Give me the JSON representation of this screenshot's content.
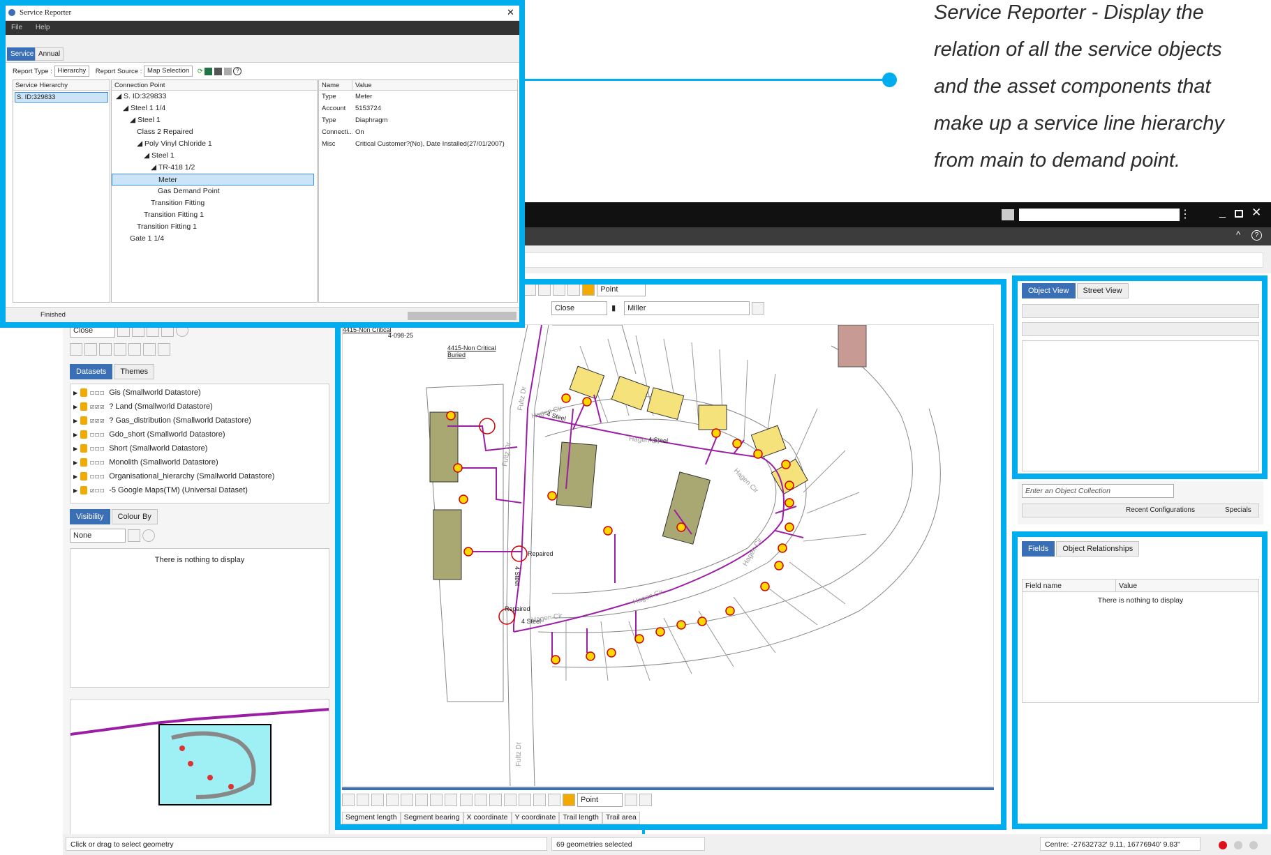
{
  "caption": {
    "lines": [
      "Service Reporter - Display the",
      "relation of all the service objects",
      "and the asset components that",
      "make up a service line hierarchy",
      "from main to demand point."
    ]
  },
  "reporter": {
    "title": "Service Reporter",
    "menu": [
      "File",
      "Help"
    ],
    "tabs": [
      "Service",
      "Annual"
    ],
    "report_type_label": "Report Type :",
    "report_type_value": "Hierarchy",
    "report_source_label": "Report Source :",
    "report_source_value": "Map Selection",
    "hier_header": "Service Hierarchy",
    "hier_item": "S. ID:329833",
    "conn_header": "Connection Point",
    "tree": [
      {
        "t": "◢ S. ID:329833",
        "d": 0
      },
      {
        "t": "◢ Steel 1 1/4",
        "d": 1
      },
      {
        "t": "◢ Steel 1",
        "d": 2
      },
      {
        "t": "Class 2 Repaired",
        "d": 3
      },
      {
        "t": "◢ Poly Vinyl Chloride 1",
        "d": 3
      },
      {
        "t": "◢ Steel 1",
        "d": 4
      },
      {
        "t": "◢ TR-418 1/2",
        "d": 5
      },
      {
        "t": "Meter",
        "d": 6
      },
      {
        "t": "Gas Demand Point",
        "d": 6
      },
      {
        "t": "Transition Fitting",
        "d": 5
      },
      {
        "t": "Transition Fitting 1",
        "d": 4
      },
      {
        "t": "Transition Fitting 1",
        "d": 3
      },
      {
        "t": "Gate 1 1/4",
        "d": 2
      }
    ],
    "props_headers": [
      "Name",
      "Value"
    ],
    "props": [
      [
        "Type",
        "Meter"
      ],
      [
        "Account",
        "5153724"
      ],
      [
        "Type",
        "Diaphragm"
      ],
      [
        "Connecti...",
        "On"
      ],
      [
        "Misc",
        "Critical Customer?(No), Date Installed(27/01/2007)"
      ]
    ],
    "status": "Finished"
  },
  "main_window": {
    "toolbar_point": "Point",
    "close_value": "Close",
    "miller_value": "Miller",
    "left_close": "Close",
    "datasets_tab": "Datasets",
    "themes_tab": "Themes",
    "datasets": [
      {
        "chk": "☐☐☐",
        "label": "Gis (Smallworld Datastore)"
      },
      {
        "chk": "☑☑☑",
        "label": "? Land (Smallworld Datastore)"
      },
      {
        "chk": "☑☑☑",
        "label": "? Gas_distribution (Smallworld Datastore)"
      },
      {
        "chk": "☐☐☐",
        "label": "Gdo_short (Smallworld Datastore)"
      },
      {
        "chk": "☐☐☐",
        "label": "Short (Smallworld Datastore)"
      },
      {
        "chk": "☐☐☐",
        "label": "Monolith (Smallworld Datastore)"
      },
      {
        "chk": "☐☐☐",
        "label": "Organisational_hierarchy (Smallworld Datastore)"
      },
      {
        "chk": "☑☐☐",
        "label": "-5 Google Maps(TM) (Universal Dataset)"
      }
    ],
    "visibility_tab": "Visibility",
    "colour_tab": "Colour By",
    "none_value": "None",
    "nothing": "There is nothing to display",
    "object_view_tab": "Object View",
    "street_view_tab": "Street View",
    "collection_placeholder": "Enter an Object Collection",
    "recent_config": "Recent Configurations",
    "specials": "Specials",
    "fields_tab": "Fields",
    "relationships_tab": "Object Relationships",
    "field_name_col": "Field name",
    "value_col": "Value",
    "bottom_point": "Point",
    "measure_tabs": [
      "Segment length",
      "Segment bearing",
      "X coordinate",
      "Y coordinate",
      "Trail length",
      "Trail area"
    ],
    "status_left": "Click or drag to select geometry",
    "status_mid": "69 geometries selected",
    "status_centre": "Centre: -27632732' 9.11, 16776940' 9.83\""
  },
  "map_labels": {
    "non_critical": "4415-Non Critical",
    "non_critical2": "4415-Non Critical Buried",
    "code": "4-098-25",
    "steel_4a": "4 Steel",
    "steel_4b": "4 Steel",
    "steel_4c": "4 Steel",
    "steel_4d": "4 Steel",
    "repaired1": "Repaired",
    "repaired2": "Repaired",
    "hagen1": "Hagen Cir",
    "hagen2": "Hagen Cir",
    "hagen3": "Hagen Cir",
    "hagen4": "Hagen Cir",
    "hagen5": "Hagen Cir",
    "hagen6": "Hagen Cir",
    "fultz1": "Fultz Dr",
    "fultz2": "Fultz Dr",
    "fultz3": "Fultz Dr"
  },
  "colors": {
    "accent": "#00AEEF",
    "pipe": "#9b1fa5",
    "tab_blue": "#3a6fb5"
  }
}
